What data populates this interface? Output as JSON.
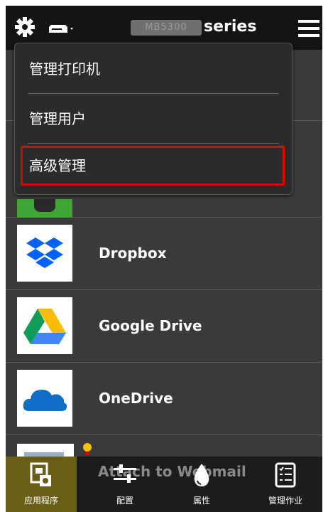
{
  "header": {
    "model_text": "MB5300",
    "series_label": "series"
  },
  "dropdown": {
    "items": [
      {
        "label": "管理打印机"
      },
      {
        "label": "管理用户"
      },
      {
        "label": "高级管理",
        "highlighted": true
      }
    ],
    "highlight_color": "#e00000"
  },
  "apps": [
    {
      "label": "Dropbox",
      "icon": "dropbox-icon"
    },
    {
      "label": "Google Drive",
      "icon": "google-drive-icon"
    },
    {
      "label": "OneDrive",
      "icon": "onedrive-icon"
    }
  ],
  "bottom_nav": {
    "overlay_text": "Attach to Webmail",
    "items": [
      {
        "label": "应用程序",
        "icon": "apps-icon",
        "active": true
      },
      {
        "label": "配置",
        "icon": "sliders-icon"
      },
      {
        "label": "属性",
        "icon": "ink-drop-icon"
      },
      {
        "label": "管理作业",
        "icon": "job-list-icon"
      }
    ]
  },
  "colors": {
    "topbar": "#141414",
    "list_bg": "#3a3a3a",
    "active_tab": "#6a5d16",
    "dropbox_blue": "#0061fe",
    "onedrive_blue": "#0f6fc6"
  }
}
